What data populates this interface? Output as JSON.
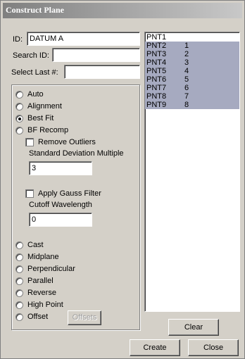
{
  "window": {
    "title": "Construct Plane"
  },
  "id_field": {
    "label": "ID:",
    "value": "DATUM A"
  },
  "search_id": {
    "label": "Search ID:",
    "value": ""
  },
  "select_last": {
    "label": "Select Last #:",
    "value": ""
  },
  "methods": [
    {
      "label": "Auto",
      "selected": false
    },
    {
      "label": "Alignment",
      "selected": false
    },
    {
      "label": "Best Fit",
      "selected": true
    },
    {
      "label": "BF Recomp",
      "selected": false
    }
  ],
  "remove_outliers": {
    "label": "Remove Outliers",
    "checked": false
  },
  "std_dev": {
    "label": "Standard Deviation Multiple",
    "value": "3"
  },
  "gauss_filter": {
    "label": "Apply Gauss Filter",
    "checked": false
  },
  "cutoff": {
    "label": "Cutoff Wavelength",
    "value": "0"
  },
  "methods2": [
    {
      "label": "Cast",
      "selected": false
    },
    {
      "label": "Midplane",
      "selected": false
    },
    {
      "label": "Perpendicular",
      "selected": false
    },
    {
      "label": "Parallel",
      "selected": false
    },
    {
      "label": "Reverse",
      "selected": false
    },
    {
      "label": "High Point",
      "selected": false
    },
    {
      "label": "Offset",
      "selected": false
    }
  ],
  "offsets_button": "Offsets",
  "list": [
    {
      "name": "PNT1",
      "index": "",
      "selected": false
    },
    {
      "name": "PNT2",
      "index": "1",
      "selected": true
    },
    {
      "name": "PNT3",
      "index": "2",
      "selected": true
    },
    {
      "name": "PNT4",
      "index": "3",
      "selected": true
    },
    {
      "name": "PNT5",
      "index": "4",
      "selected": true
    },
    {
      "name": "PNT6",
      "index": "5",
      "selected": true
    },
    {
      "name": "PNT7",
      "index": "6",
      "selected": true
    },
    {
      "name": "PNT8",
      "index": "7",
      "selected": true
    },
    {
      "name": "PNT9",
      "index": "8",
      "selected": true
    }
  ],
  "buttons": {
    "clear": "Clear",
    "create": "Create",
    "close": "Close"
  }
}
